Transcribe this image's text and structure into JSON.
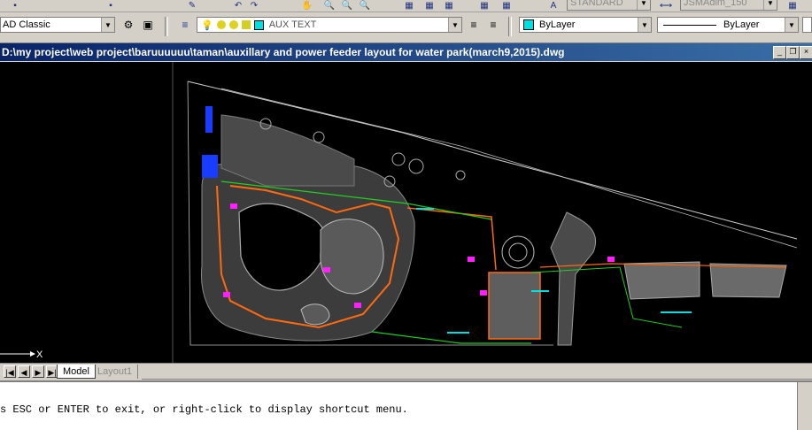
{
  "toolbar_top": {
    "text_style": "STANDARD",
    "dim_style": "JSMAdim_150"
  },
  "toolbar_workspace": {
    "workspace": "AD Classic",
    "layer": "AUX TEXT",
    "color": "ByLayer",
    "linetype": "ByLayer"
  },
  "drawing": {
    "title": "D:\\my project\\web project\\baruuuuuu\\taman\\auxillary and power feeder layout for water park(march9,2015).dwg",
    "ucs_x_label": "X"
  },
  "layout_tabs": [
    {
      "label": "Model"
    },
    {
      "label": "Layout1"
    }
  ],
  "command": {
    "line1": "",
    "line2": "s ESC or ENTER to exit, or right-click to display shortcut menu."
  }
}
